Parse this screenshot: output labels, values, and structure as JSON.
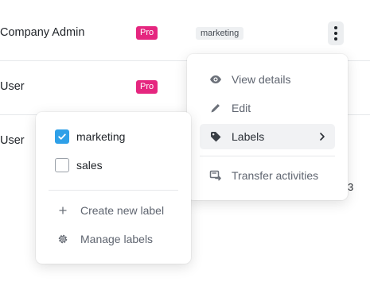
{
  "rows": [
    {
      "role": "Company Admin",
      "plan_badge": "Pro",
      "label_tag": "marketing"
    },
    {
      "role": "User",
      "plan_badge": "Pro"
    },
    {
      "role": "User"
    }
  ],
  "partial_cell_text": "3",
  "actions_menu": {
    "items": [
      {
        "label": "View details",
        "icon": "eye-icon"
      },
      {
        "label": "Edit",
        "icon": "pencil-icon"
      },
      {
        "label": "Labels",
        "icon": "tag-icon",
        "highlighted": true,
        "has_submenu": true
      },
      {
        "label": "Transfer activities",
        "icon": "transfer-icon"
      }
    ]
  },
  "labels_menu": {
    "labels": [
      {
        "name": "marketing",
        "checked": true
      },
      {
        "name": "sales",
        "checked": false
      }
    ],
    "actions": [
      {
        "label": "Create new label",
        "icon": "plus-icon"
      },
      {
        "label": "Manage labels",
        "icon": "gear-icon"
      }
    ]
  },
  "colors": {
    "pro_badge": "#e5267f",
    "checkbox_checked": "#2fa0e8",
    "menu_highlight": "#f1f2f4",
    "tag_chip_bg": "#eef0f2"
  }
}
